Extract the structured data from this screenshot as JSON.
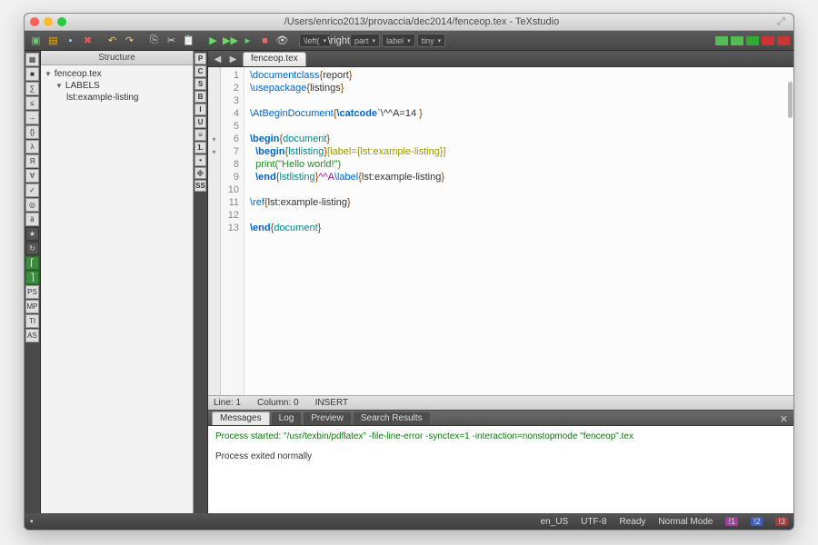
{
  "window": {
    "title": "/Users/enrico2013/provaccia/dec2014/fenceop.tex - TeXstudio"
  },
  "toolbar": {
    "selects": [
      "\\left(",
      "part",
      "label",
      "tiny"
    ]
  },
  "structure": {
    "header": "Structure",
    "file": "fenceop.tex",
    "labelsHeader": "LABELS",
    "label1": "lst:example-listing"
  },
  "tabs": {
    "file": "fenceop.tex"
  },
  "code": {
    "lines": [
      "1",
      "2",
      "3",
      "4",
      "5",
      "6",
      "7",
      "8",
      "9",
      "10",
      "11",
      "12",
      "13"
    ],
    "l1_cmd": "\\documentclass",
    "l1_arg": "report",
    "l2_cmd": "\\usepackage",
    "l2_arg": "listings",
    "l4_cmd": "\\AtBeginDocument",
    "l4_inner": "\\catcode",
    "l4_rest": "`\\^^A=14 ",
    "l6_cmd": "\\begin",
    "l6_arg": "document",
    "l7_cmd": "\\begin",
    "l7_arg": "lstlisting",
    "l7_opt": "[label={lst:example-listing}]",
    "l8": "print(\"Hello world!\")",
    "l9_cmd": "\\end",
    "l9_arg": "lstlisting",
    "l9_mid": "^^A",
    "l9_lbl": "\\label",
    "l9_larg": "lst:example-listing",
    "l11_cmd": "\\ref",
    "l11_arg": "lst:example-listing",
    "l13_cmd": "\\end",
    "l13_arg": "document"
  },
  "status": {
    "line": "Line: 1",
    "col": "Column: 0",
    "mode": "INSERT"
  },
  "messages": {
    "tabs": [
      "Messages",
      "Log",
      "Preview",
      "Search Results"
    ],
    "started": "Process started: \"/usr/texbin/pdflatex\" -file-line-error -synctex=1 -interaction=nonstopmode \"fenceop\".tex",
    "exited": "Process exited normally"
  },
  "bottom": {
    "lang": "en_US",
    "enc": "UTF-8",
    "ready": "Ready",
    "mode": "Normal Mode",
    "b1": "!1",
    "b2": "!2",
    "b3": "!3"
  }
}
